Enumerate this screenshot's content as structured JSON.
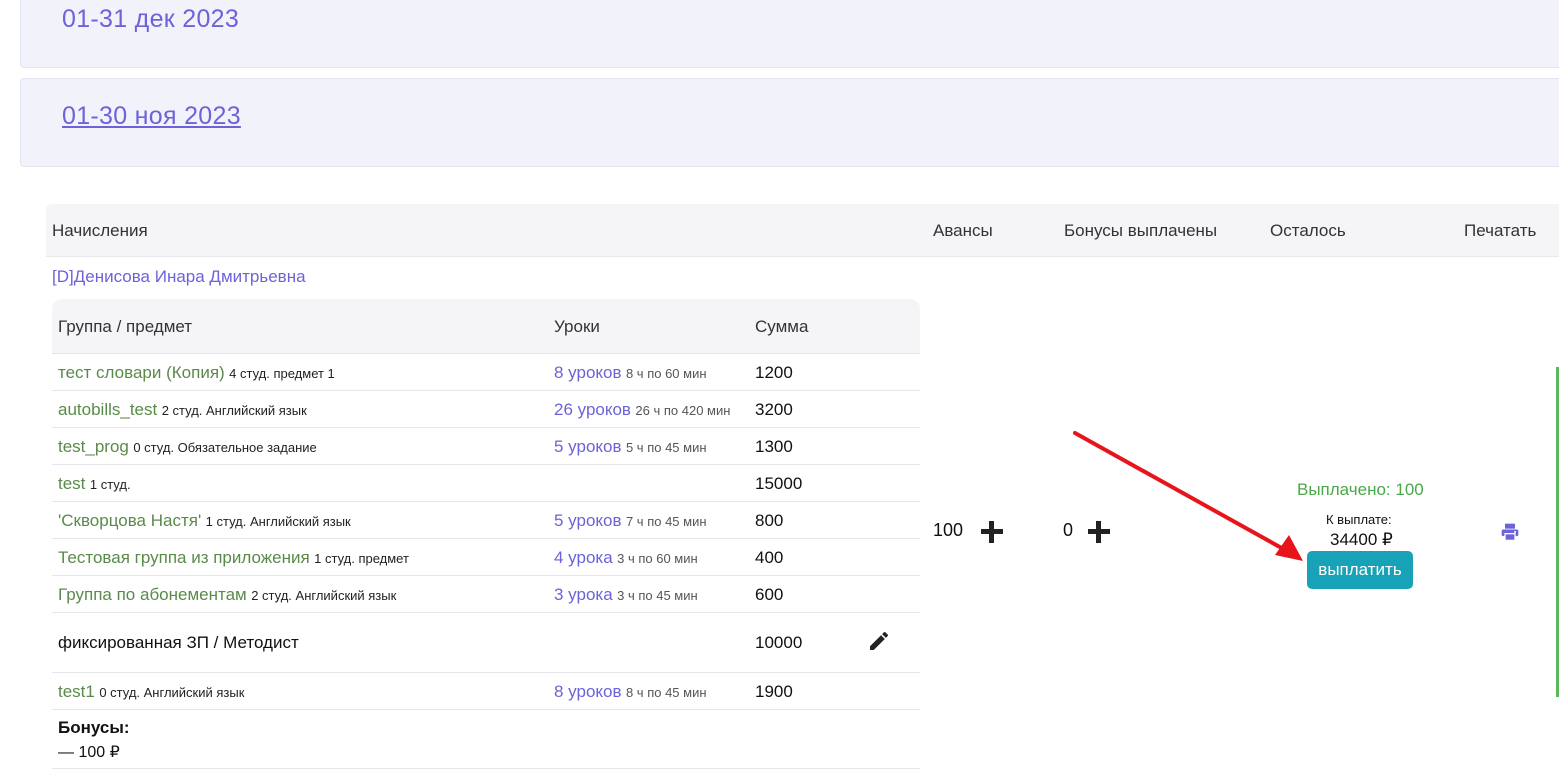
{
  "periods": [
    {
      "title": "01-31 дек 2023"
    },
    {
      "title": "01-30 ноя 2023"
    }
  ],
  "table_head": {
    "accruals": "Начисления",
    "advances": "Авансы",
    "bonuses_paid": "Бонусы выплачены",
    "remaining": "Осталось",
    "print": "Печатать"
  },
  "teacher": {
    "name": "[D]Денисова Инара Дмитрьевна"
  },
  "inner_head": {
    "group": "Группа / предмет",
    "lessons": "Уроки",
    "sum": "Сумма"
  },
  "rows": [
    {
      "group": "тест словари (Копия)",
      "meta": "4 студ. предмет 1",
      "lessons": "8 уроков",
      "lessons_meta": "8 ч по 60 мин",
      "sum": "1200"
    },
    {
      "group": "autobills_test",
      "meta": "2 студ. Английский язык",
      "lessons": "26 уроков",
      "lessons_meta": "26 ч по 420 мин",
      "sum": "3200"
    },
    {
      "group": "test_prog",
      "meta": "0 студ. Обязательное задание",
      "lessons": "5 уроков",
      "lessons_meta": "5 ч по 45 мин",
      "sum": "1300"
    },
    {
      "group": "test",
      "meta": "1 студ.",
      "lessons": "",
      "lessons_meta": "",
      "sum": "15000"
    },
    {
      "group": "'Скворцова Настя'",
      "meta": "1 студ. Английский язык",
      "lessons": "5 уроков",
      "lessons_meta": "7 ч по 45 мин",
      "sum": "800"
    },
    {
      "group": "Тестовая группа из приложения",
      "meta": "1 студ. предмет",
      "lessons": "4 урока",
      "lessons_meta": "3 ч по 60 мин",
      "sum": "400"
    },
    {
      "group": "Группа по абонементам",
      "meta": "2 студ. Английский язык",
      "lessons": "3 урока",
      "lessons_meta": "3 ч по 45 мин",
      "sum": "600"
    }
  ],
  "fixed": {
    "label": "фиксированная ЗП / Методист",
    "sum": "10000",
    "icon": "pencil-icon"
  },
  "last_row": {
    "group": "test1",
    "meta": "0 студ. Английский язык",
    "lessons": "8 уроков",
    "lessons_meta": "8 ч по 45 мин",
    "sum": "1900"
  },
  "bonuses": {
    "title": "Бонусы:",
    "line": "— 100 ₽"
  },
  "advances": {
    "value": "100",
    "icon": "plus-icon"
  },
  "bonuses_paid": {
    "value": "0",
    "icon": "plus-icon"
  },
  "remaining": {
    "paid": "Выплачено: 100",
    "to_pay_label": "К выплате:",
    "to_pay_amount": "34400 ₽",
    "pay_button": "выплатить"
  },
  "print": {
    "icon": "printer-icon"
  },
  "colors": {
    "accent": "#6c63d9",
    "link_green": "#5a8a4a",
    "paid_green": "#4aa84a",
    "button": "#17a2b8",
    "arrow": "#e8141c"
  }
}
